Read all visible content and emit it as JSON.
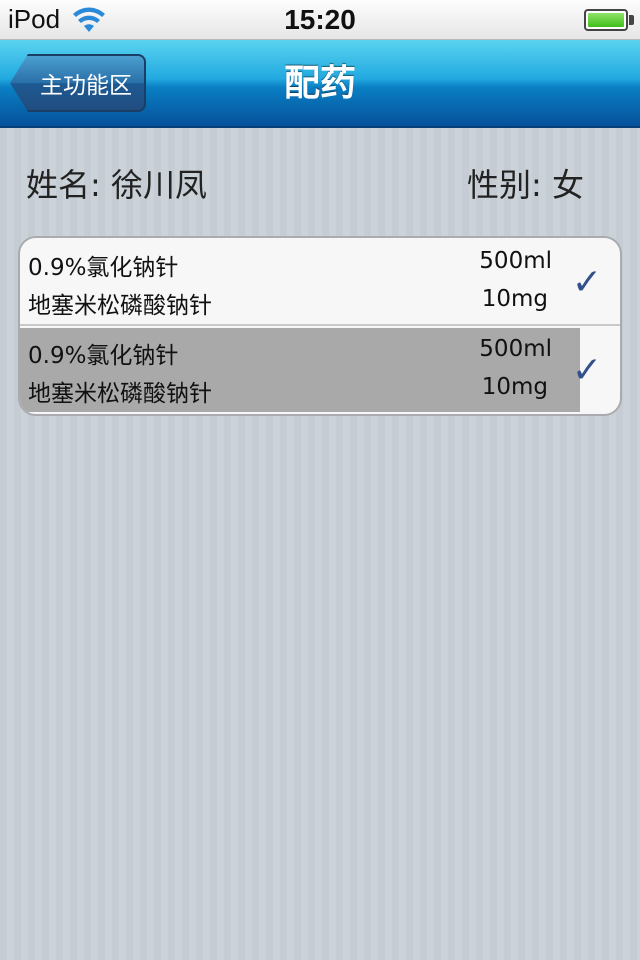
{
  "status_bar": {
    "carrier": "iPod",
    "time": "15:20",
    "wifi_icon": "wifi-icon",
    "battery_icon": "battery-full-icon",
    "battery_color": "#3fbf1a"
  },
  "nav_bar": {
    "back_label": "主功能区",
    "title": "配药",
    "gradient_top": "#5ad3f0",
    "gradient_bottom": "#06519a"
  },
  "patient": {
    "name_label": "姓名: 徐川凤",
    "gender_label": "性别: 女"
  },
  "prescriptions": [
    {
      "drug1": "0.9%氯化钠针",
      "dose1": "500ml",
      "drug2": "地塞米松磷酸钠针",
      "dose2": "10mg",
      "checked": true,
      "check_icon": "checkmark-icon",
      "highlighted": false
    },
    {
      "drug1": "0.9%氯化钠针",
      "dose1": "500ml",
      "drug2": "地塞米松磷酸钠针",
      "dose2": "10mg",
      "checked": true,
      "check_icon": "checkmark-icon",
      "highlighted": true
    }
  ],
  "accent_color": "#33508a"
}
